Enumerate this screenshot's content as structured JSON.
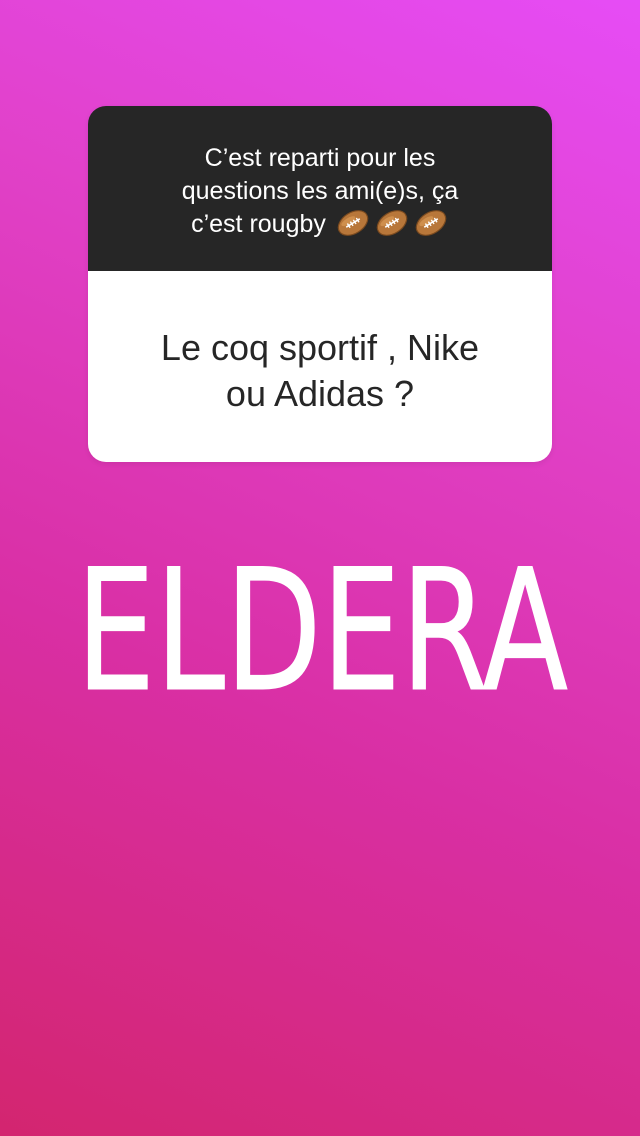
{
  "question_sticker": {
    "prompt_lines": [
      "C’est reparti pour les",
      "questions les ami(e)s, ça",
      "c’est rougby"
    ],
    "prompt_emoji": [
      "rugby-ball-icon",
      "rugby-ball-icon",
      "rugby-ball-icon"
    ],
    "answer_lines": [
      "Le coq sportif , Nike",
      "ou Adidas ?"
    ]
  },
  "overlay_text": "ELDERA",
  "colors": {
    "gradient_start": "#d3256f",
    "gradient_end": "#e64cf6",
    "prompt_background": "#262626",
    "answer_background": "#ffffff",
    "text_light": "#ffffff",
    "text_dark": "#262626"
  }
}
